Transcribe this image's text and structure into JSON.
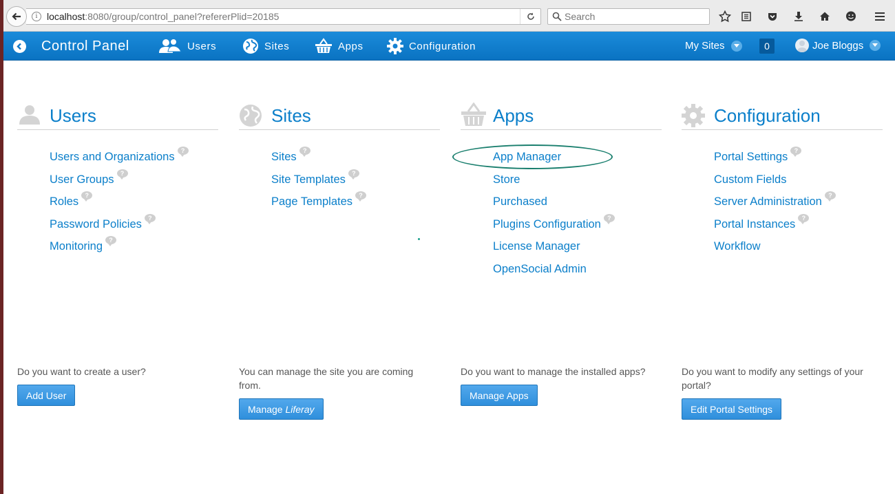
{
  "browser": {
    "url_host": "localhost",
    "url_rest": ":8080/group/control_panel?refererPlid=20185",
    "search_placeholder": "Search"
  },
  "dockbar": {
    "title": "Control Panel",
    "nav": {
      "users": "Users",
      "sites": "Sites",
      "apps": "Apps",
      "configuration": "Configuration"
    },
    "my_sites": "My Sites",
    "notifications_count": "0",
    "user_name": "Joe Bloggs"
  },
  "columns": {
    "users": {
      "title": "Users",
      "links": [
        "Users and Organizations",
        "User Groups",
        "Roles",
        "Password Policies",
        "Monitoring"
      ],
      "prompt": "Do you want to create a user?",
      "button": "Add User"
    },
    "sites": {
      "title": "Sites",
      "links": [
        "Sites",
        "Site Templates",
        "Page Templates"
      ],
      "prompt": "You can manage the site you are coming from.",
      "button_prefix": "Manage ",
      "button_site": "Liferay"
    },
    "apps": {
      "title": "Apps",
      "links": [
        "App Manager",
        "Store",
        "Purchased",
        "Plugins Configuration",
        "License Manager",
        "OpenSocial Admin"
      ],
      "prompt": "Do you want to manage the installed apps?",
      "button": "Manage Apps"
    },
    "configuration": {
      "title": "Configuration",
      "links": [
        "Portal Settings",
        "Custom Fields",
        "Server Administration",
        "Portal Instances",
        "Workflow"
      ],
      "prompt": "Do you want to modify any settings of your portal?",
      "button": "Edit Portal Settings"
    }
  },
  "colors": {
    "accent": "#0b7fca",
    "dockbar": "#1581d2",
    "annotation": "#1a7f6e"
  }
}
